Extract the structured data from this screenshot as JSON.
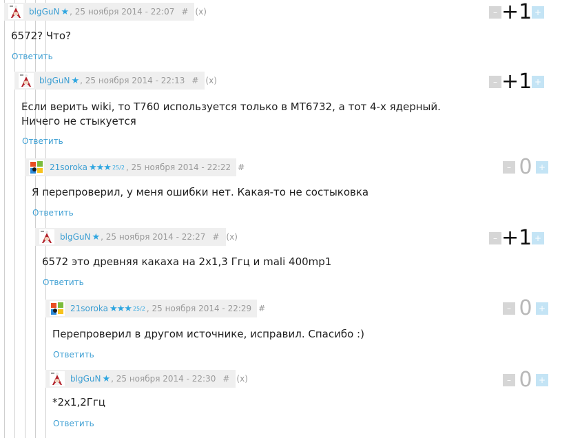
{
  "comments": [
    {
      "user": "blgGuN",
      "stars": "★",
      "rank": "",
      "date": ", 25 ноября 2014 - 22:07",
      "hash": "#",
      "x": "(x)",
      "lines": [
        "6572? Что?"
      ],
      "reply": "Ответить",
      "score": "+1",
      "minus": "–",
      "plus": "+",
      "avatar": "santa-avatar"
    },
    {
      "user": "blgGuN",
      "stars": "★",
      "rank": "",
      "date": ", 25 ноября 2014 - 22:13",
      "hash": "#",
      "x": "(x)",
      "lines": [
        "Если верить wiki, то T760 используется только в MT6732, а тот 4-х ядерный.",
        "Ничего не стыкуется"
      ],
      "reply": "Ответить",
      "score": "+1",
      "minus": "–",
      "plus": "+",
      "avatar": "santa-avatar"
    },
    {
      "user": "21soroka",
      "stars": "★★★",
      "rank": "25/2",
      "date": ", 25 ноября 2014 - 22:22",
      "hash": "#",
      "x": "",
      "lines": [
        "Я перепроверил, у меня ошибки нет. Какая-то не состыковка"
      ],
      "reply": "Ответить",
      "score": "0",
      "minus": "–",
      "plus": "+",
      "avatar": "windows-avatar"
    },
    {
      "user": "blgGuN",
      "stars": "★",
      "rank": "",
      "date": ", 25 ноября 2014 - 22:27",
      "hash": "#",
      "x": "(x)",
      "lines": [
        "6572 это древняя какаха на 2х1,3 Ггц и mali 400mp1"
      ],
      "reply": "Ответить",
      "score": "+1",
      "minus": "–",
      "plus": "+",
      "avatar": "santa-avatar"
    },
    {
      "user": "21soroka",
      "stars": "★★★",
      "rank": "25/2",
      "date": ", 25 ноября 2014 - 22:29",
      "hash": "#",
      "x": "",
      "lines": [
        "Перепроверил в другом источнике, исправил. Спасибо :)"
      ],
      "reply": "Ответить",
      "score": "0",
      "minus": "–",
      "plus": "+",
      "avatar": "windows-avatar"
    },
    {
      "user": "blgGuN",
      "stars": "★",
      "rank": "",
      "date": ", 25 ноября 2014 - 22:30",
      "hash": "#",
      "x": "(x)",
      "lines": [
        "*2х1,2Ггц"
      ],
      "reply": "Ответить",
      "score": "0",
      "minus": "–",
      "plus": "+",
      "avatar": "santa-avatar"
    }
  ]
}
